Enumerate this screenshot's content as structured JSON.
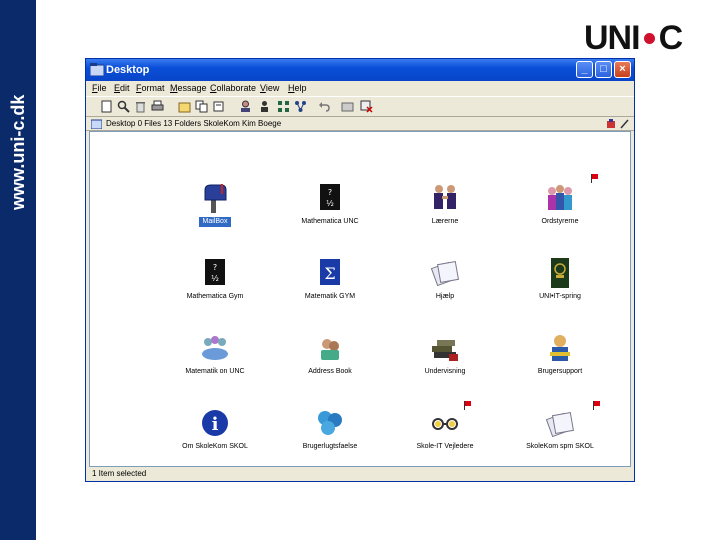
{
  "side": {
    "url": "www.uni-c.dk"
  },
  "logo": {
    "left_text": "UNI",
    "right_text": "C"
  },
  "window": {
    "title": "Desktop",
    "menu": [
      "File",
      "Edit",
      "Format",
      "Message",
      "Collaborate",
      "View",
      "Help"
    ],
    "toolbar_icons": [
      "new-icon",
      "find-icon",
      "delete-icon",
      "print-icon",
      "open-icon",
      "copy-icon",
      "attach-icon",
      "user-icon",
      "grid-icon",
      "network-icon",
      "undo-icon",
      "folder-icon",
      "close-folder-icon"
    ],
    "path_text": "Desktop  0 Files  13 Folders  SkoleKom  Kim Boege",
    "status": "1 Item selected"
  },
  "items": [
    {
      "label": "MailBox",
      "icon": "mailbox-icon",
      "selected": true,
      "flag": false
    },
    {
      "label": "Mathematica UNC",
      "icon": "math-book-icon",
      "selected": false,
      "flag": false
    },
    {
      "label": "Lærerne",
      "icon": "people-icon",
      "selected": false,
      "flag": false
    },
    {
      "label": "Ordstyrerne",
      "icon": "group-icon",
      "selected": false,
      "flag": true
    },
    {
      "label": "Mathematica Gym",
      "icon": "math-book-icon",
      "selected": false,
      "flag": false
    },
    {
      "label": "Matematik GYM",
      "icon": "sigma-book-icon",
      "selected": false,
      "flag": false
    },
    {
      "label": "Hjælp",
      "icon": "help-icon",
      "selected": false,
      "flag": false
    },
    {
      "label": "UNI•IT-spring",
      "icon": "crest-icon",
      "selected": false,
      "flag": false
    },
    {
      "label": "Matematik on UNC",
      "icon": "team-icon",
      "selected": false,
      "flag": false
    },
    {
      "label": "Address Book",
      "icon": "address-book-icon",
      "selected": false,
      "flag": false
    },
    {
      "label": "Undervisning",
      "icon": "books-icon",
      "selected": false,
      "flag": false
    },
    {
      "label": "Brugersupport",
      "icon": "support-person-icon",
      "selected": false,
      "flag": false
    },
    {
      "label": "Om SkoleKom SKOL",
      "icon": "info-icon",
      "selected": false,
      "flag": false
    },
    {
      "label": "Brugerlugtsfaelse",
      "icon": "puzzle-icon",
      "selected": false,
      "flag": false
    },
    {
      "label": "Skole-IT Vejledere",
      "icon": "glasses-icon",
      "selected": false,
      "flag": true
    },
    {
      "label": "SkoleKom spm SKOL",
      "icon": "documents-icon",
      "selected": false,
      "flag": true
    }
  ]
}
